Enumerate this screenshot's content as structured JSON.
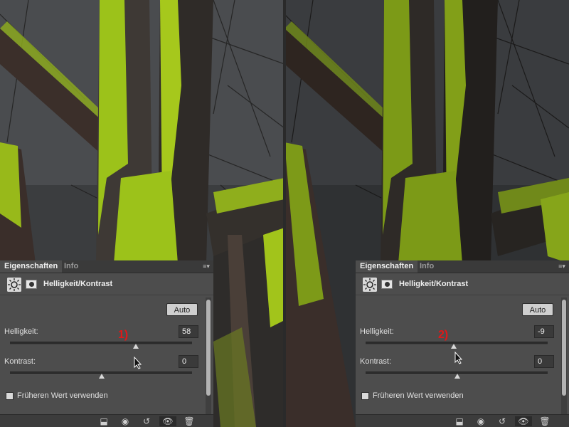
{
  "panels": [
    {
      "tabs": {
        "active": "Eigenschaften",
        "inactive": "Info"
      },
      "adjustment_title": "Helligkeit/Kontrast",
      "auto_label": "Auto",
      "brightness": {
        "label": "Helligkeit:",
        "value": "58",
        "level": 0.69
      },
      "contrast": {
        "label": "Kontrast:",
        "value": "0",
        "level": 0.5
      },
      "annotation": "1)",
      "legacy_label": "Früheren Wert verwenden"
    },
    {
      "tabs": {
        "active": "Eigenschaften",
        "inactive": "Info"
      },
      "adjustment_title": "Helligkeit/Kontrast",
      "auto_label": "Auto",
      "brightness": {
        "label": "Helligkeit:",
        "value": "-9",
        "level": 0.47
      },
      "contrast": {
        "label": "Kontrast:",
        "value": "0",
        "level": 0.5
      },
      "annotation": "2)",
      "legacy_label": "Früheren Wert verwenden"
    }
  ],
  "colors": {
    "moss": "#9fc21a",
    "annotation": "#e01818",
    "panel": "#4d4d4d"
  },
  "icons": [
    "sun-icon",
    "layer-mask-icon",
    "panel-menu-icon",
    "clip-to-layer-icon",
    "view-previous-icon",
    "reset-icon",
    "visibility-eye-icon",
    "trash-icon"
  ]
}
